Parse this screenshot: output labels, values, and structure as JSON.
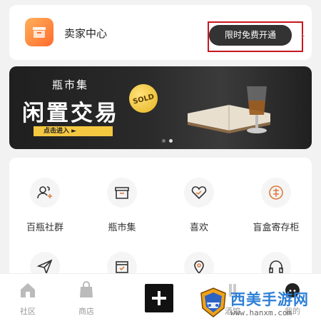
{
  "seller": {
    "title": "卖家中心",
    "button_label": "限时免费开通",
    "chevron": "›"
  },
  "banner": {
    "subtitle": "瓶市集",
    "title": "闲置交易",
    "cta": "点击进入 ►",
    "badge": "SOLD"
  },
  "grid": {
    "items": [
      {
        "label": "百瓶社群",
        "icon": "community-icon"
      },
      {
        "label": "瓶市集",
        "icon": "shop-box-icon"
      },
      {
        "label": "喜欢",
        "icon": "heart-icon"
      },
      {
        "label": "盲盒寄存柜",
        "icon": "storage-icon"
      }
    ],
    "row2_icons": [
      "paper-plane-icon",
      "calendar-icon",
      "location-pin-icon",
      "headphones-icon"
    ]
  },
  "tabbar": {
    "tabs": [
      {
        "label": "社区",
        "icon": "home-icon"
      },
      {
        "label": "商店",
        "icon": "bag-icon"
      },
      {
        "label": "",
        "icon": "plus-icon"
      },
      {
        "label": "酒馆",
        "icon": "bar-icon"
      },
      {
        "label": "我的",
        "icon": "profile-icon"
      }
    ]
  },
  "watermark": {
    "title": "西美手游网",
    "url": "www.hanxm.com"
  },
  "colors": {
    "accent": "#333333",
    "highlight": "#c8161d",
    "cta": "#f5c842",
    "watermark": "#2d7fd6"
  }
}
